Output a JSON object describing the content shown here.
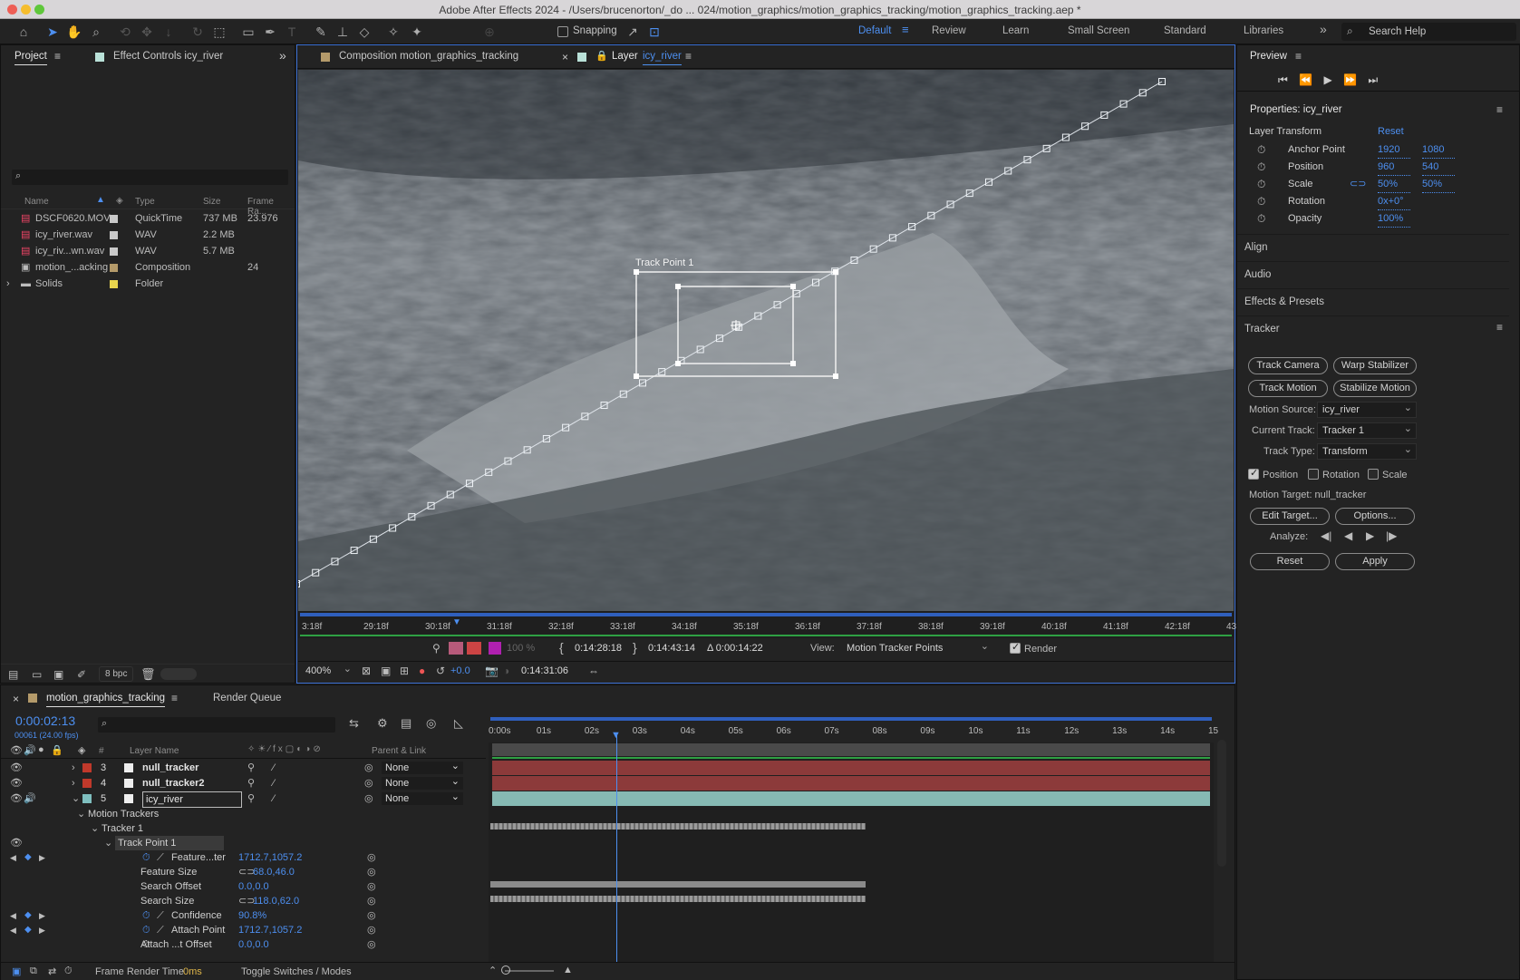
{
  "window": {
    "title": "Adobe After Effects 2024 - /Users/brucenorton/_do ... 024/motion_graphics/motion_graphics_tracking/motion_graphics_tracking.aep *"
  },
  "toolbar": {
    "snapping_label": "Snapping",
    "workspaces": [
      "Default",
      "Review",
      "Learn",
      "Small Screen",
      "Standard",
      "Libraries"
    ],
    "search_placeholder": "Search Help"
  },
  "project_panel": {
    "tab_project": "Project",
    "tab_effect": "Effect Controls icy_river",
    "columns": {
      "name": "Name",
      "type": "Type",
      "size": "Size",
      "frame_rate": "Frame Ra..."
    },
    "items": [
      {
        "name": "DSCF0620.MOV",
        "type": "QuickTime",
        "size": "737 MB",
        "rate": "23.976",
        "color": "#c9c9c9",
        "icon": "footage-icon"
      },
      {
        "name": "icy_river.wav",
        "type": "WAV",
        "size": "2.2 MB",
        "rate": "",
        "color": "#c9c9c9",
        "icon": "audio-file-icon"
      },
      {
        "name": "icy_riv...wn.wav",
        "type": "WAV",
        "size": "5.7 MB",
        "rate": "",
        "color": "#c9c9c9",
        "icon": "audio-file-icon"
      },
      {
        "name": "motion_...acking",
        "type": "Composition",
        "size": "",
        "rate": "24",
        "color": "#b49a6a",
        "icon": "composition-icon"
      },
      {
        "name": "Solids",
        "type": "Folder",
        "size": "",
        "rate": "",
        "color": "#e8d44d",
        "icon": "folder-icon"
      }
    ],
    "bpc": "8 bpc"
  },
  "viewer": {
    "tab_comp": "Composition motion_graphics_tracking",
    "tab_layer_prefix": "Layer",
    "tab_layer_name": "icy_river",
    "track_point_label": "Track Point 1",
    "ruler_labels": [
      "3:18f",
      "29:18f",
      "30:18f",
      "31:18f",
      "32:18f",
      "33:18f",
      "34:18f",
      "35:18f",
      "36:18f",
      "37:18f",
      "38:18f",
      "39:18f",
      "40:18f",
      "41:18f",
      "42:18f",
      "43:1"
    ],
    "in_time": "0:14:28:18",
    "out_time": "0:14:43:14",
    "duration": "Δ 0:00:14:22",
    "view_label": "View:",
    "view_value": "Motion Tracker Points",
    "render_label": "Render",
    "opacity_pct": "100 %",
    "zoom": "400%",
    "exposure": "+0.0",
    "current_time": "0:14:31:06"
  },
  "preview": {
    "title": "Preview"
  },
  "properties": {
    "title": "Properties: icy_river",
    "section": "Layer Transform",
    "reset": "Reset",
    "rows": [
      {
        "label": "Anchor Point",
        "v1": "1920",
        "v2": "1080"
      },
      {
        "label": "Position",
        "v1": "960",
        "v2": "540"
      },
      {
        "label": "Scale",
        "v1": "50%",
        "v2": "50%"
      },
      {
        "label": "Rotation",
        "v1": "0x+0°",
        "v2": ""
      },
      {
        "label": "Opacity",
        "v1": "100%",
        "v2": ""
      }
    ]
  },
  "sections": {
    "align": "Align",
    "audio": "Audio",
    "effects": "Effects & Presets",
    "tracker": "Tracker"
  },
  "tracker": {
    "track_camera": "Track Camera",
    "warp_stabilizer": "Warp Stabilizer",
    "track_motion": "Track Motion",
    "stabilize_motion": "Stabilize Motion",
    "motion_source_label": "Motion Source:",
    "motion_source": "icy_river",
    "current_track_label": "Current Track:",
    "current_track": "Tracker 1",
    "track_type_label": "Track Type:",
    "track_type": "Transform",
    "position": "Position",
    "rotation": "Rotation",
    "scale": "Scale",
    "motion_target": "Motion Target: null_tracker",
    "edit_target": "Edit Target...",
    "options": "Options...",
    "analyze": "Analyze:",
    "reset": "Reset",
    "apply": "Apply"
  },
  "timeline": {
    "tab_comp": "motion_graphics_tracking",
    "tab_render": "Render Queue",
    "timecode": "0:00:02:13",
    "frames": "00061 (24.00 fps)",
    "layer_name_header": "Layer Name",
    "num_header": "#",
    "parent_header": "Parent & Link",
    "ruler": [
      "0:00s",
      "01s",
      "02s",
      "03s",
      "04s",
      "05s",
      "06s",
      "07s",
      "08s",
      "09s",
      "10s",
      "11s",
      "12s",
      "13s",
      "14s",
      "15"
    ],
    "layers": [
      {
        "num": "3",
        "name": "null_tracker",
        "parent": "None",
        "color": "#c0392b"
      },
      {
        "num": "4",
        "name": "null_tracker2",
        "parent": "None",
        "color": "#c0392b"
      },
      {
        "num": "5",
        "name": "icy_river",
        "parent": "None",
        "color": "#7fbfbf"
      }
    ],
    "props": [
      {
        "name": "Motion Trackers",
        "value": "",
        "indent": 1
      },
      {
        "name": "Tracker 1",
        "value": "",
        "indent": 2
      },
      {
        "name": "Track Point 1",
        "value": "",
        "indent": 3
      },
      {
        "name": "Feature...ter",
        "value": "1712.7,1057.2",
        "indent": 4
      },
      {
        "name": "Feature Size",
        "value": "68.0,46.0",
        "indent": 4
      },
      {
        "name": "Search Offset",
        "value": "0.0,0.0",
        "indent": 4
      },
      {
        "name": "Search Size",
        "value": "118.0,62.0",
        "indent": 4
      },
      {
        "name": "Confidence",
        "value": "90.8%",
        "indent": 4
      },
      {
        "name": "Attach Point",
        "value": "1712.7,1057.2",
        "indent": 4
      },
      {
        "name": "Attach ...t Offset",
        "value": "0.0,0.0",
        "indent": 4
      }
    ],
    "footer_render_label": "Frame Render Time",
    "footer_render_value": "0ms",
    "footer_toggle": "Toggle Switches / Modes"
  }
}
